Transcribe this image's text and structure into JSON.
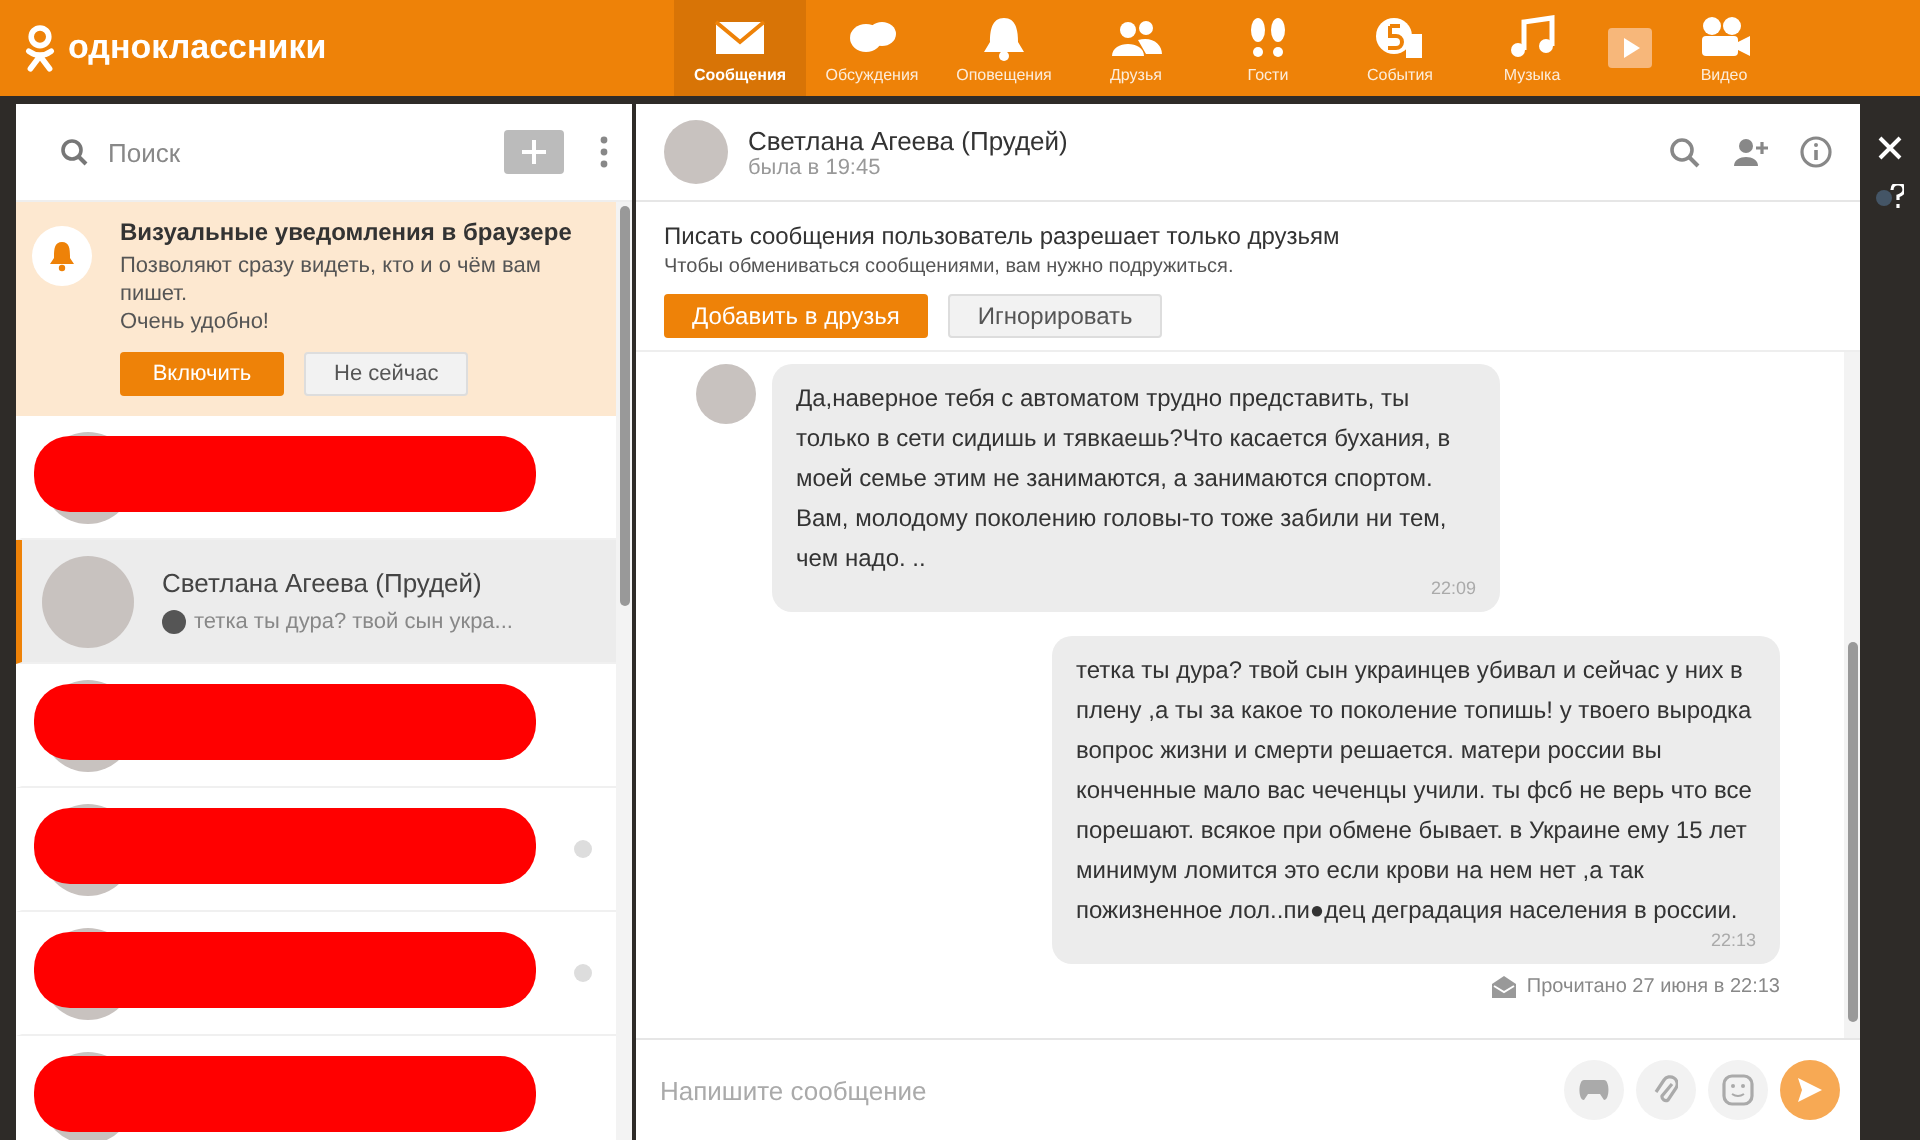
{
  "brand": {
    "name": "одноклассники"
  },
  "nav": [
    {
      "label": "Сообщения",
      "selected": true
    },
    {
      "label": "Обсуждения",
      "selected": false
    },
    {
      "label": "Оповещения",
      "selected": false
    },
    {
      "label": "Друзья",
      "selected": false
    },
    {
      "label": "Гости",
      "selected": false
    },
    {
      "label": "События",
      "selected": false
    },
    {
      "label": "Музыка",
      "selected": false
    },
    {
      "selected": false
    },
    {
      "label": "Видео",
      "selected": false
    }
  ],
  "sidebar": {
    "search": {
      "placeholder": "Поиск"
    },
    "notice": {
      "title": "Визуальные уведомления в браузере",
      "text": "Позволяют сразу видеть, кто и о чём вам пишет.",
      "note": "Очень удобно!",
      "buttons": [
        {
          "label": "Включить",
          "kind": "primary"
        },
        {
          "label": "Не сейчас",
          "kind": "secondary"
        }
      ]
    },
    "conversations": [
      {
        "kind": "redacted",
        "selected": false,
        "unread_dot": false
      },
      {
        "kind": "chat",
        "name": "Светлана Агеева (Прудей)",
        "preview": "тетка ты дура? твой сын укра...",
        "selected": true,
        "unread_dot": false
      },
      {
        "kind": "redacted",
        "selected": false,
        "unread_dot": false
      },
      {
        "kind": "redacted",
        "selected": false,
        "unread_dot": true
      },
      {
        "kind": "redacted",
        "selected": false,
        "unread_dot": true
      },
      {
        "kind": "redacted",
        "selected": false,
        "unread_dot": false
      }
    ]
  },
  "chat": {
    "name": "Светлана Агеева (Прудей)",
    "status": "была в 19:45",
    "restriction": {
      "title": "Писать сообщения пользователь разрешает только друзьям",
      "text": "Чтобы обмениваться сообщениями, вам нужно подружиться.",
      "buttons": [
        {
          "label": "Добавить в друзья",
          "kind": "primary"
        },
        {
          "label": "Игнорировать",
          "kind": "secondary"
        }
      ]
    },
    "messages": [
      {
        "kind": "incoming",
        "text": "Да,наверное тебя с автоматом трудно представить, ты только в сети сидишь и тявкаешь?Что касается бухания, в моей семье этим не занимаются, а занимаются спортом. Вам, молодому поколению головы-то тоже забили ни тем, чем надо. ..",
        "time": "22:09"
      },
      {
        "kind": "outgoing",
        "text": "тетка ты дура? твой сын украинцев убивал и сейчас у них в плену ,а ты за какое то поколение топишь! у твоего выродка вопрос жизни и смерти решается. матери россии вы конченные мало вас чеченцы учили. ты фсб не верь что все порешают. всякое при обмене бывает. в Украине ему 15 лет минимум ломится это если крови на нем нет ,а так пожизненное лол..пи●дец деградация населения в россии.",
        "time": "22:13",
        "receipt": "Прочитано 27 июня в 22:13"
      }
    ],
    "composer": {
      "placeholder": "Напишите сообщение"
    }
  }
}
